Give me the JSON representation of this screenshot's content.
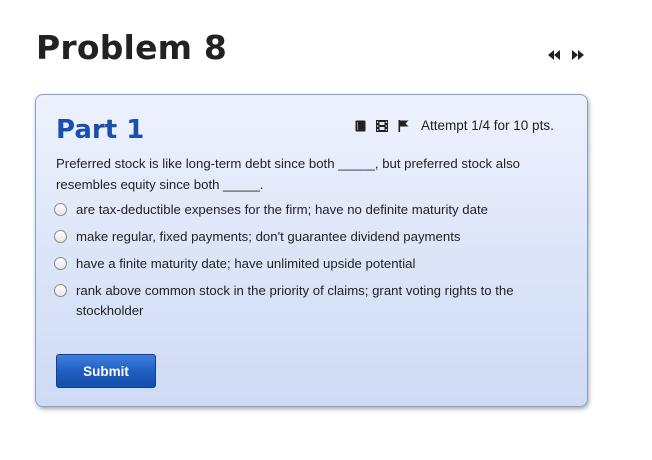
{
  "problem": {
    "title": "Problem 8"
  },
  "nav": {
    "prev_icon": "rewind-icon",
    "next_icon": "fast-forward-icon"
  },
  "part": {
    "title": "Part 1",
    "tools": {
      "icons": [
        "book-icon",
        "film-icon",
        "flag-icon"
      ],
      "attempt_text": "Attempt 1/4 for 10 pts."
    },
    "question": "Preferred stock is like long-term debt since both _____, but preferred stock also resembles equity since both _____.",
    "choices": [
      "are tax-deductible expenses for the firm; have no definite maturity date",
      "make regular, fixed payments; don't guarantee dividend payments",
      "have a finite maturity date; have unlimited upside potential",
      "rank above common stock in the priority of claims; grant voting rights to the stockholder"
    ],
    "submit_label": "Submit"
  },
  "colors": {
    "part_title": "#1a4fb0",
    "card_border": "#7ea3d6",
    "card_background": "#dbe4f8",
    "submit_button": "#1f5fc4"
  }
}
